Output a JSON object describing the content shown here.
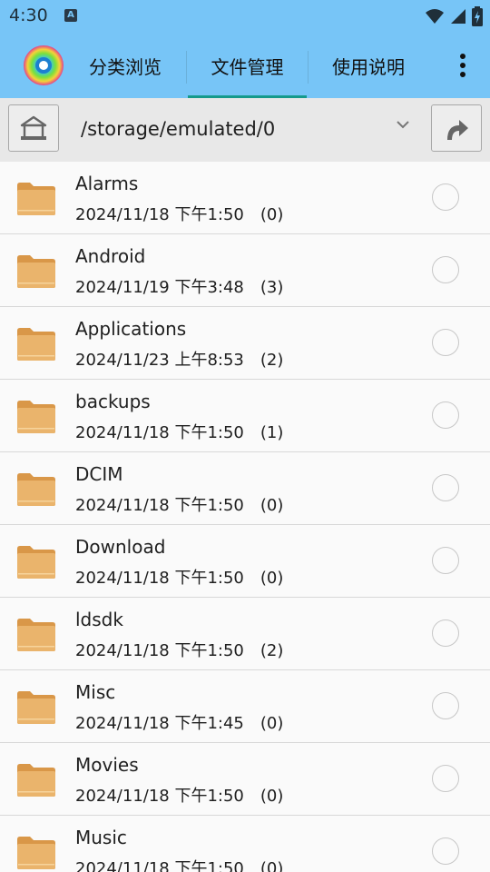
{
  "status_bar": {
    "time": "4:30",
    "notification_badge": "A"
  },
  "top_bar": {
    "tabs": [
      {
        "label": "分类浏览",
        "active": false
      },
      {
        "label": "文件管理",
        "active": true
      },
      {
        "label": "使用说明",
        "active": false
      }
    ]
  },
  "path_bar": {
    "path": "/storage/emulated/0"
  },
  "files": [
    {
      "name": "Alarms",
      "date": "2024/11/18 下午1:50",
      "count": "(0)"
    },
    {
      "name": "Android",
      "date": "2024/11/19 下午3:48",
      "count": "(3)"
    },
    {
      "name": "Applications",
      "date": "2024/11/23 上午8:53",
      "count": "(2)"
    },
    {
      "name": "backups",
      "date": "2024/11/18 下午1:50",
      "count": "(1)"
    },
    {
      "name": "DCIM",
      "date": "2024/11/18 下午1:50",
      "count": "(0)"
    },
    {
      "name": "Download",
      "date": "2024/11/18 下午1:50",
      "count": "(0)"
    },
    {
      "name": "ldsdk",
      "date": "2024/11/18 下午1:50",
      "count": "(2)"
    },
    {
      "name": "Misc",
      "date": "2024/11/18 下午1:45",
      "count": "(0)"
    },
    {
      "name": "Movies",
      "date": "2024/11/18 下午1:50",
      "count": "(0)"
    },
    {
      "name": "Music",
      "date": "2024/11/18 下午1:50",
      "count": "(0)"
    }
  ],
  "colors": {
    "header": "#77c5f7",
    "tab_indicator": "#149a8c",
    "folder": "#e8aa62"
  }
}
